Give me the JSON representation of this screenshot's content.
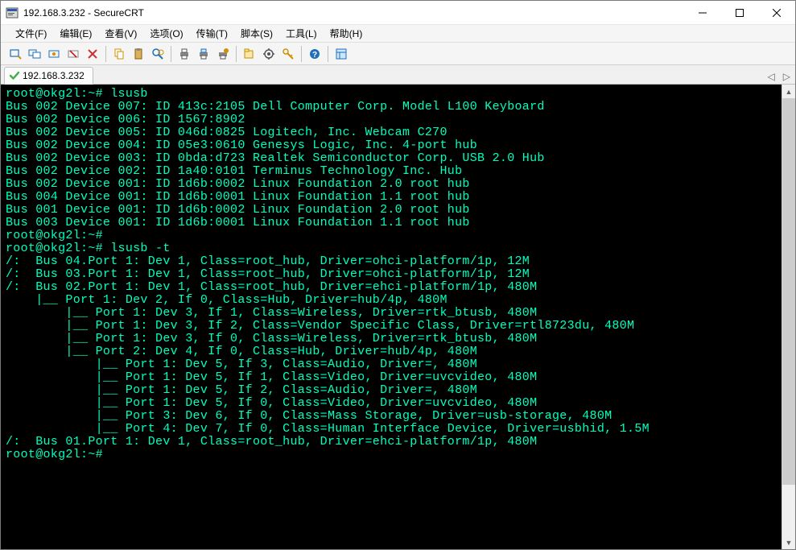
{
  "window": {
    "title": "192.168.3.232 - SecureCRT"
  },
  "menubar": {
    "items": [
      "文件(F)",
      "编辑(E)",
      "查看(V)",
      "选项(O)",
      "传输(T)",
      "脚本(S)",
      "工具(L)",
      "帮助(H)"
    ]
  },
  "toolbar": {
    "icons": [
      "quick-connect-icon",
      "reconnect-icon",
      "reconnect-alt-icon",
      "disconnect-icon",
      "stop-icon",
      "sep",
      "copy-icon",
      "paste-icon",
      "find-icon",
      "sep",
      "print-icon",
      "print-screen-icon",
      "print-setup-icon",
      "sep",
      "new-tab-icon",
      "settings-icon",
      "key-icon",
      "sep",
      "help-icon",
      "sep",
      "session-mgr-icon"
    ]
  },
  "tab": {
    "label": "192.168.3.232"
  },
  "terminal_lines": [
    "root@okg2l:~# lsusb",
    "Bus 002 Device 007: ID 413c:2105 Dell Computer Corp. Model L100 Keyboard",
    "Bus 002 Device 006: ID 1567:8902",
    "Bus 002 Device 005: ID 046d:0825 Logitech, Inc. Webcam C270",
    "Bus 002 Device 004: ID 05e3:0610 Genesys Logic, Inc. 4-port hub",
    "Bus 002 Device 003: ID 0bda:d723 Realtek Semiconductor Corp. USB 2.0 Hub",
    "Bus 002 Device 002: ID 1a40:0101 Terminus Technology Inc. Hub",
    "Bus 002 Device 001: ID 1d6b:0002 Linux Foundation 2.0 root hub",
    "Bus 004 Device 001: ID 1d6b:0001 Linux Foundation 1.1 root hub",
    "Bus 001 Device 001: ID 1d6b:0002 Linux Foundation 2.0 root hub",
    "Bus 003 Device 001: ID 1d6b:0001 Linux Foundation 1.1 root hub",
    "root@okg2l:~#",
    "root@okg2l:~# lsusb -t",
    "/:  Bus 04.Port 1: Dev 1, Class=root_hub, Driver=ohci-platform/1p, 12M",
    "/:  Bus 03.Port 1: Dev 1, Class=root_hub, Driver=ohci-platform/1p, 12M",
    "/:  Bus 02.Port 1: Dev 1, Class=root_hub, Driver=ehci-platform/1p, 480M",
    "    |__ Port 1: Dev 2, If 0, Class=Hub, Driver=hub/4p, 480M",
    "        |__ Port 1: Dev 3, If 1, Class=Wireless, Driver=rtk_btusb, 480M",
    "        |__ Port 1: Dev 3, If 2, Class=Vendor Specific Class, Driver=rtl8723du, 480M",
    "        |__ Port 1: Dev 3, If 0, Class=Wireless, Driver=rtk_btusb, 480M",
    "        |__ Port 2: Dev 4, If 0, Class=Hub, Driver=hub/4p, 480M",
    "            |__ Port 1: Dev 5, If 3, Class=Audio, Driver=, 480M",
    "            |__ Port 1: Dev 5, If 1, Class=Video, Driver=uvcvideo, 480M",
    "            |__ Port 1: Dev 5, If 2, Class=Audio, Driver=, 480M",
    "            |__ Port 1: Dev 5, If 0, Class=Video, Driver=uvcvideo, 480M",
    "            |__ Port 3: Dev 6, If 0, Class=Mass Storage, Driver=usb-storage, 480M",
    "            |__ Port 4: Dev 7, If 0, Class=Human Interface Device, Driver=usbhid, 1.5M",
    "/:  Bus 01.Port 1: Dev 1, Class=root_hub, Driver=ehci-platform/1p, 480M",
    "root@okg2l:~#"
  ]
}
